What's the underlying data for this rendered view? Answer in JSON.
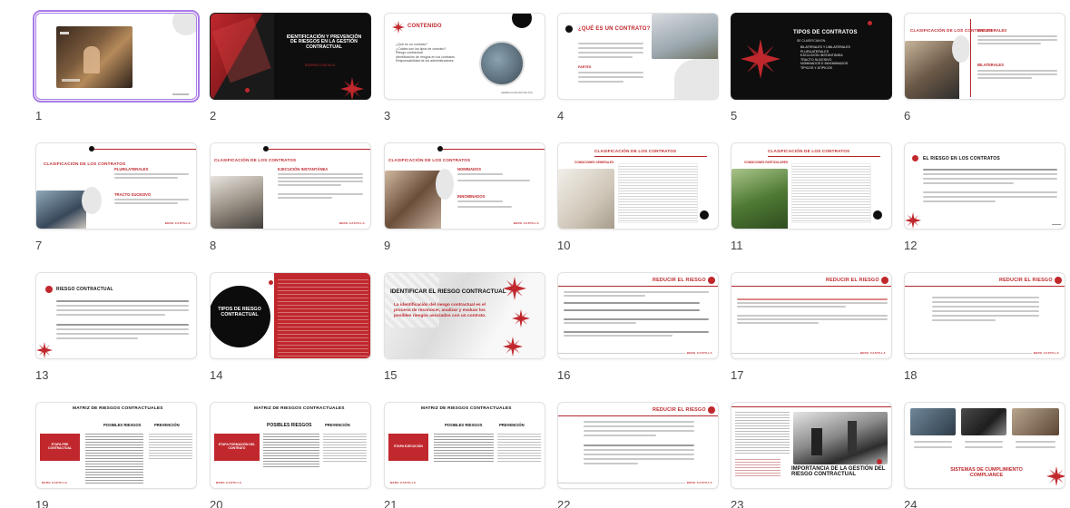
{
  "slides": [
    {
      "number": "1",
      "selected": true
    },
    {
      "number": "2",
      "title": "IDENTIFICACIÓN Y PREVENCIÓN DE RIESGOS EN LA GESTIÓN CONTRACTUAL",
      "subtitle": "RODRIGO CASTILLA"
    },
    {
      "number": "3",
      "title": "CONTENIDO",
      "items": [
        "¿Qué es un contrato?",
        "¿Cuáles son los tipos de contrato?",
        "Riesgo contractual",
        "Identificación de riesgos en los contratos",
        "Responsabilidad de los administradores"
      ]
    },
    {
      "number": "4",
      "title": "¿QUÉ ES UN CONTRATO?",
      "sub": "PARTES"
    },
    {
      "number": "5",
      "title": "TIPOS DE CONTRATOS",
      "sub": "SE CLASIFICAN EN:",
      "items": [
        "BILATERALES Y UNILATERALES",
        "PLURILATERALES",
        "EJECUCIÓN INSTANTÁNEA",
        "TRACTO SUCESIVO",
        "NOMINADOS E INNOMINADOS",
        "TÍPICOS Y ATÍPICOS"
      ]
    },
    {
      "number": "6",
      "title": "CLASIFICACIÓN DE LOS CONTRATOS",
      "heads": [
        "UNILATERALES",
        "BILATERALES"
      ]
    },
    {
      "number": "7",
      "title": "CLASIFICACIÓN DE LOS CONTRATOS",
      "heads": [
        "PLURILATERALES",
        "TRACTO SUCESIVO"
      ]
    },
    {
      "number": "8",
      "title": "CLASIFICACIÓN DE LOS CONTRATOS",
      "heads": [
        "EJECUCIÓN INSTANTÁNEA"
      ]
    },
    {
      "number": "9",
      "title": "CLASIFICACIÓN DE LOS CONTRATOS",
      "heads": [
        "NOMINADOS",
        "INNOMINADOS"
      ]
    },
    {
      "number": "10",
      "title": "CLASIFICACIÓN DE LOS CONTRATOS",
      "sub": "CONDICIONES GENERALES"
    },
    {
      "number": "11",
      "title": "CLASIFICACIÓN DE LOS CONTRATOS",
      "sub": "CONDICIONES PARTICULARES"
    },
    {
      "number": "12",
      "title": "EL RIESGO EN LOS CONTRATOS"
    },
    {
      "number": "13",
      "title": "RIESGO CONTRACTUAL"
    },
    {
      "number": "14",
      "title": "TIPOS DE RIESGO CONTRACTUAL"
    },
    {
      "number": "15",
      "title": "IDENTIFICAR EL RIESGO CONTRACTUAL",
      "body": "La identificación del riesgo contractual es el proceso de reconocer, analizar y evaluar los posibles riesgos asociados con un contrato."
    },
    {
      "number": "16",
      "title": "REDUCIR EL RIESGO"
    },
    {
      "number": "17",
      "title": "REDUCIR EL RIESGO"
    },
    {
      "number": "18",
      "title": "REDUCIR EL RIESGO"
    },
    {
      "number": "19",
      "title": "MATRIZ DE RIESGOS CONTRACTUALES",
      "heads": [
        "POSIBLES RIESGOS",
        "PREVENCIÓN"
      ],
      "label": "ETAPA PRE CONTRACTUAL"
    },
    {
      "number": "20",
      "title": "MATRIZ DE RIESGOS CONTRACTUALES",
      "heads": [
        "POSIBLES RIESGOS",
        "PREVENCIÓN"
      ],
      "label": "ETAPA FORMACIÓN DEL CONTRATO"
    },
    {
      "number": "21",
      "title": "MATRIZ DE RIESGOS CONTRACTUALES",
      "heads": [
        "POSIBLES RIESGOS",
        "PREVENCIÓN"
      ],
      "label": "ETAPA EJECUCIÓN"
    },
    {
      "number": "22",
      "title": "REDUCIR EL RIESGO"
    },
    {
      "number": "23",
      "title": "IMPORTANCIA DE LA GESTIÓN DEL RIESGO CONTRACTUAL"
    },
    {
      "number": "24",
      "title": "SISTEMAS DE CUMPLIMIENTO COMPLIANCE"
    }
  ],
  "brand": {
    "logo": "BERG CASTILLA",
    "accent": "#c0282d",
    "selection": "#a97be8"
  }
}
